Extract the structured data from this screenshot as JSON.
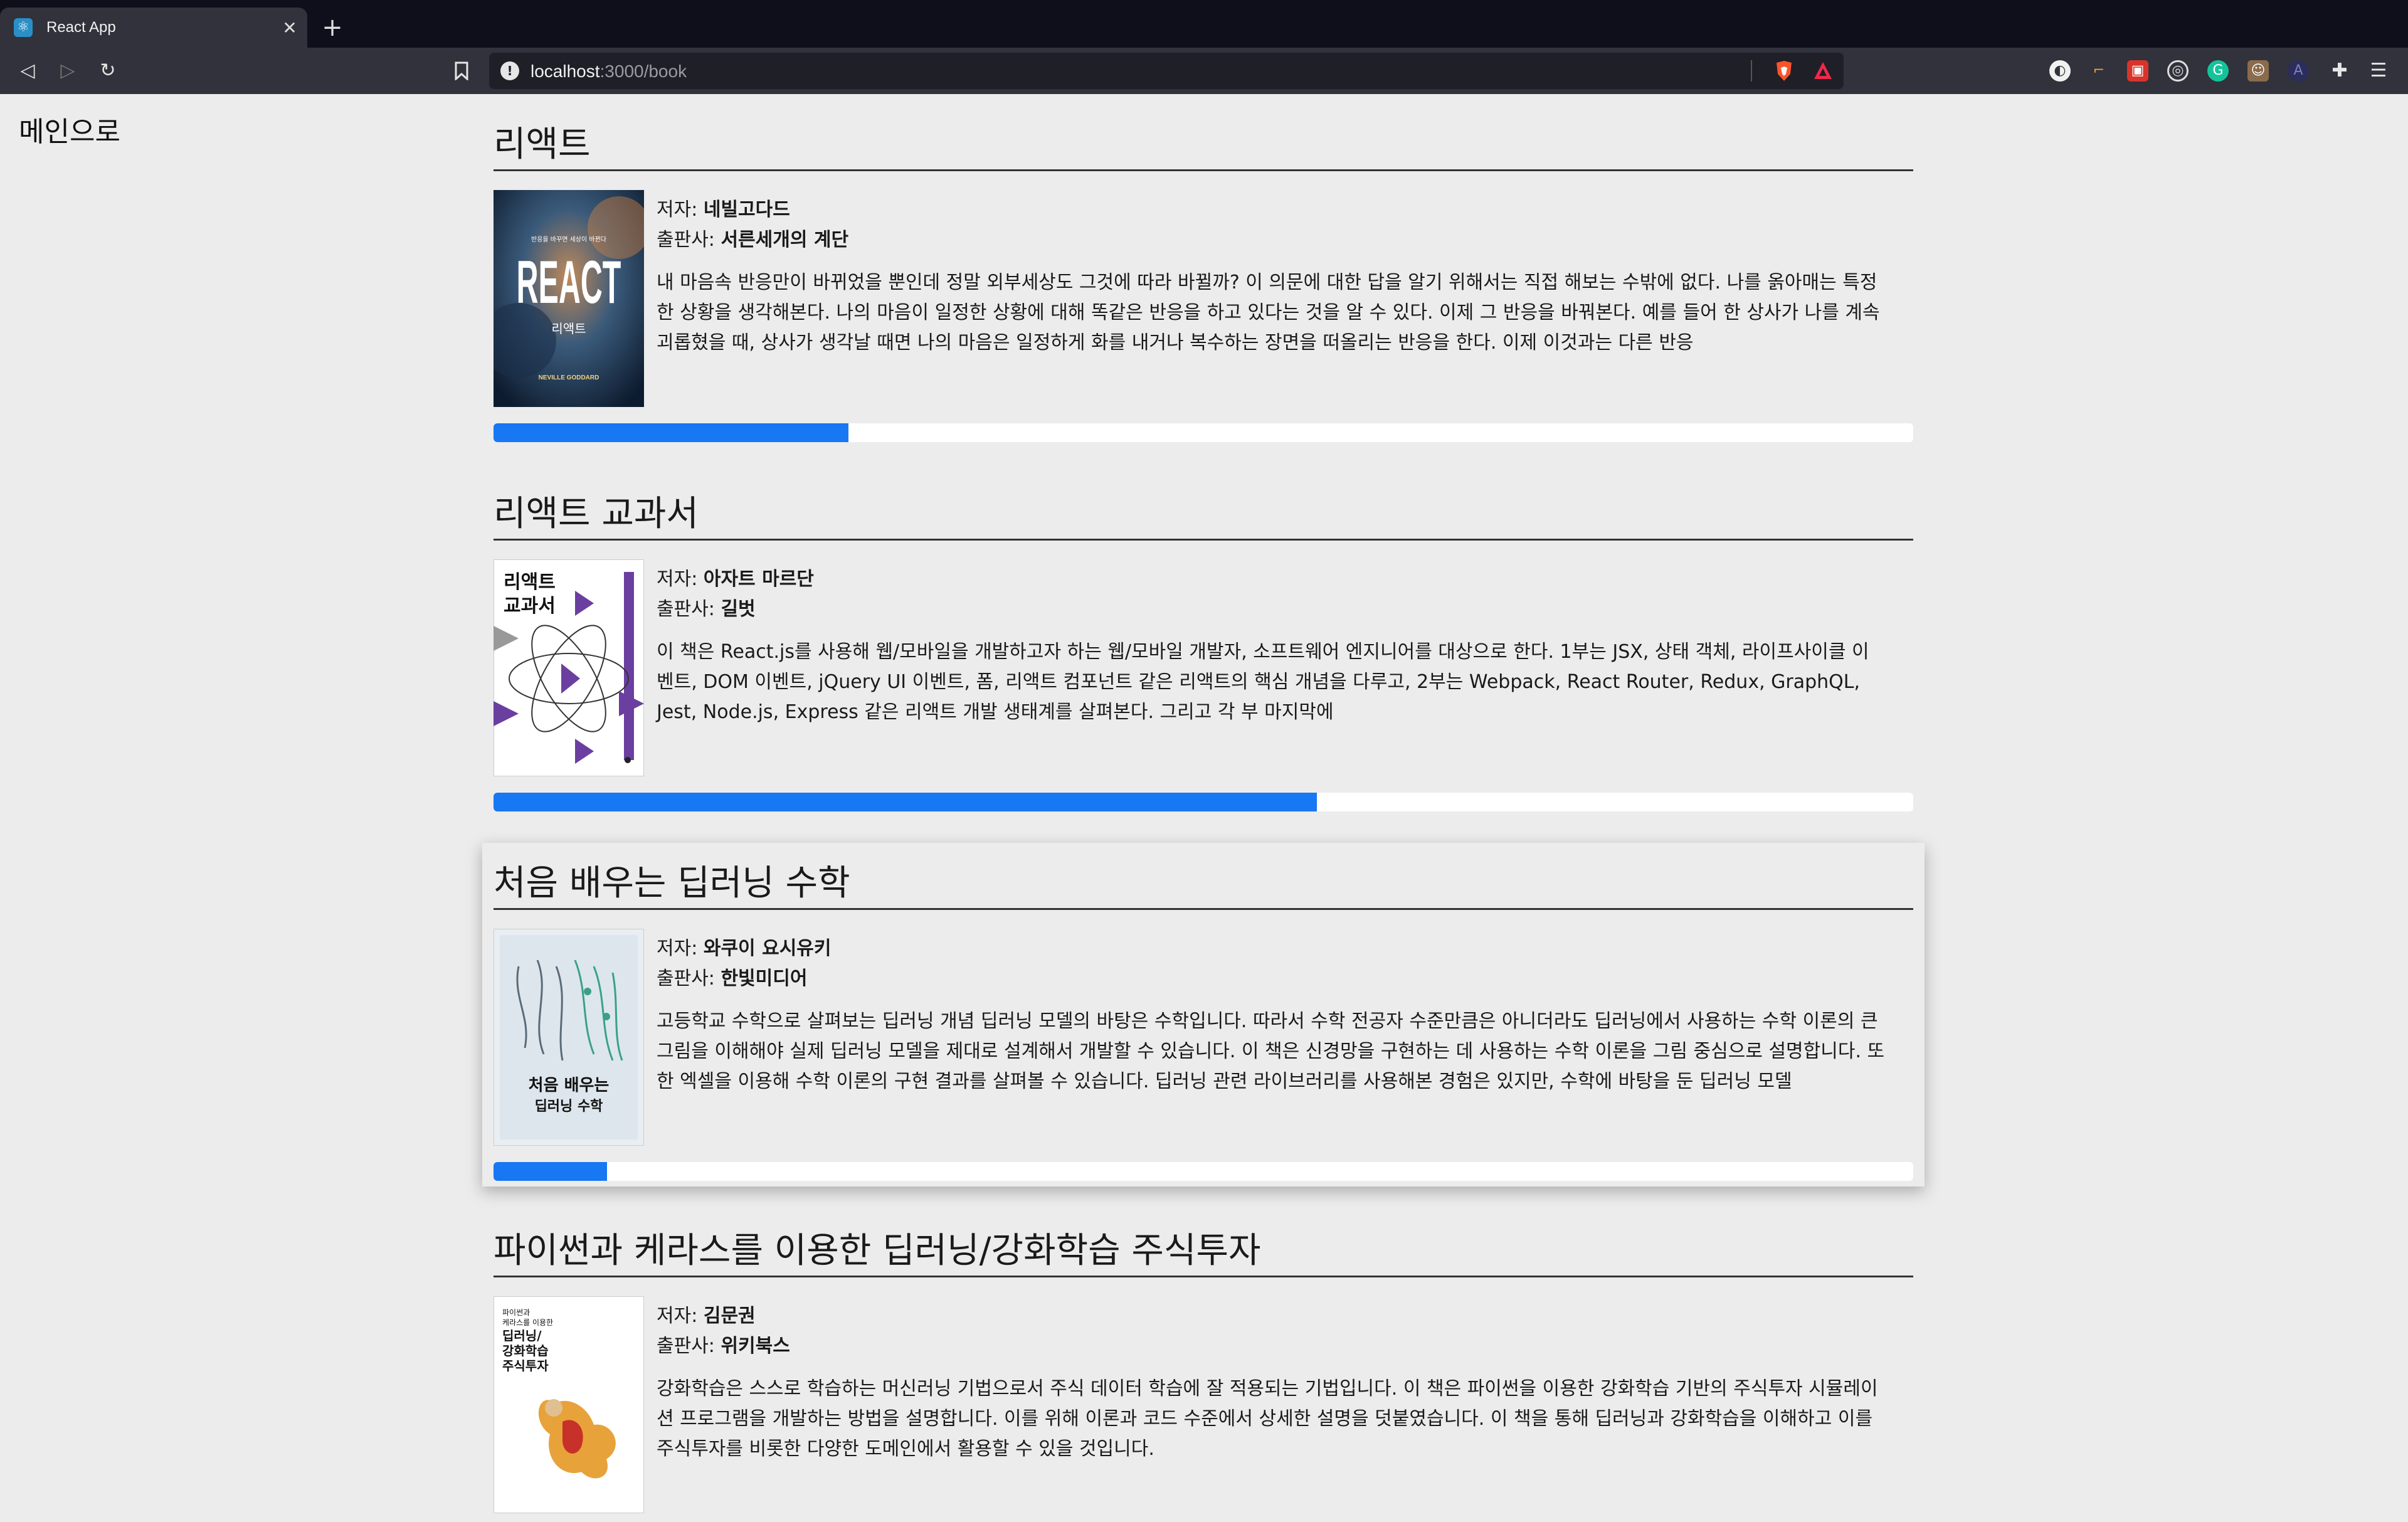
{
  "browser": {
    "tab_title": "React App",
    "url_host": "localhost",
    "url_path": ":3000/book"
  },
  "page": {
    "back_link": "메인으로"
  },
  "books": [
    {
      "title": "리액트",
      "author_label": "저자: ",
      "author": "네빌고다드",
      "publisher_label": "출판사: ",
      "publisher": "서른세개의 계단",
      "description": "내 마음속 반응만이 바뀌었을 뿐인데 정말 외부세상도 그것에 따라 바뀔까? 이 의문에 대한 답을 알기 위해서는 직접 해보는 수밖에 없다. 나를 옭아매는 특정한 상황을 생각해본다. 나의 마음이 일정한 상황에 대해 똑같은 반응을 하고 있다는 것을 알 수 있다. 이제 그 반응을 바꿔본다. 예를 들어 한 상사가 나를 계속 괴롭혔을 때, 상사가 생각날 때면 나의 마음은 일정하게 화를 내거나 복수하는 장면을 떠올리는 반응을 한다. 이제 이것과는 다른 반응",
      "progress": 0.25
    },
    {
      "title": "리액트 교과서",
      "author_label": "저자: ",
      "author": "아자트 마르단",
      "publisher_label": "출판사: ",
      "publisher": "길벗",
      "description": "이 책은 React.js를 사용해 웹/모바일을 개발하고자 하는 웹/모바일 개발자, 소프트웨어 엔지니어를 대상으로 한다. 1부는 JSX, 상태 객체, 라이프사이클 이벤트, DOM 이벤트, jQuery UI 이벤트, 폼, 리액트 컴포넌트 같은 리액트의 핵심 개념을 다루고, 2부는 Webpack, React Router, Redux, GraphQL, Jest, Node.js, Express 같은 리액트 개발 생태계를 살펴본다. 그리고 각 부 마지막에",
      "progress": 0.58
    },
    {
      "title": "처음 배우는 딥러닝 수학",
      "author_label": "저자: ",
      "author": "와쿠이 요시유키",
      "publisher_label": "출판사: ",
      "publisher": "한빛미디어",
      "description": "고등학교 수학으로 살펴보는 딥러닝 개념 딥러닝 모델의 바탕은 수학입니다. 따라서 수학 전공자 수준만큼은 아니더라도 딥러닝에서 사용하는 수학 이론의 큰 그림을 이해해야 실제 딥러닝 모델을 제대로 설계해서 개발할 수 있습니다. 이 책은 신경망을 구현하는 데 사용하는 수학 이론을 그림 중심으로 설명합니다. 또한 엑셀을 이용해 수학 이론의 구현 결과를 살펴볼 수 있습니다. 딥러닝 관련 라이브러리를 사용해본 경험은 있지만, 수학에 바탕을 둔 딥러닝 모델",
      "progress": 0.08
    },
    {
      "title": "파이썬과 케라스를 이용한 딥러닝/강화학습 주식투자",
      "author_label": "저자: ",
      "author": "김문권",
      "publisher_label": "출판사: ",
      "publisher": "위키북스",
      "description": "강화학습은 스스로 학습하는 머신러닝 기법으로서 주식 데이터 학습에 잘 적용되는 기법입니다. 이 책은 파이썬을 이용한 강화학습 기반의 주식투자 시뮬레이션 프로그램을 개발하는 방법을 설명합니다. 이를 위해 이론과 코드 수준에서 상세한 설명을 덧붙였습니다. 이 책을 통해 딥러닝과 강화학습을 이해하고 이를 주식투자를 비롯한 다양한 도메인에서 활용할 수 있을 것입니다.",
      "progress": null
    }
  ],
  "covers": {
    "react": {
      "big": "REACT",
      "sub": "리액트",
      "author": "NEVILLE GODDARD",
      "tagline": "반응을 바꾸면 세상이 바뀐다"
    },
    "textbook": {
      "title": "리액트\n교과서"
    },
    "dlmath": {
      "title": "처음 배우는",
      "title2": "딥러닝 수학"
    },
    "stock": {
      "l1": "파이썬과",
      "l2": "케라스를 이용한",
      "l3": "딥러닝/",
      "l4": "강화학습",
      "l5": "주식투자"
    }
  },
  "colors": {
    "accent": "#1877f2",
    "page_bg": "#ececec"
  }
}
